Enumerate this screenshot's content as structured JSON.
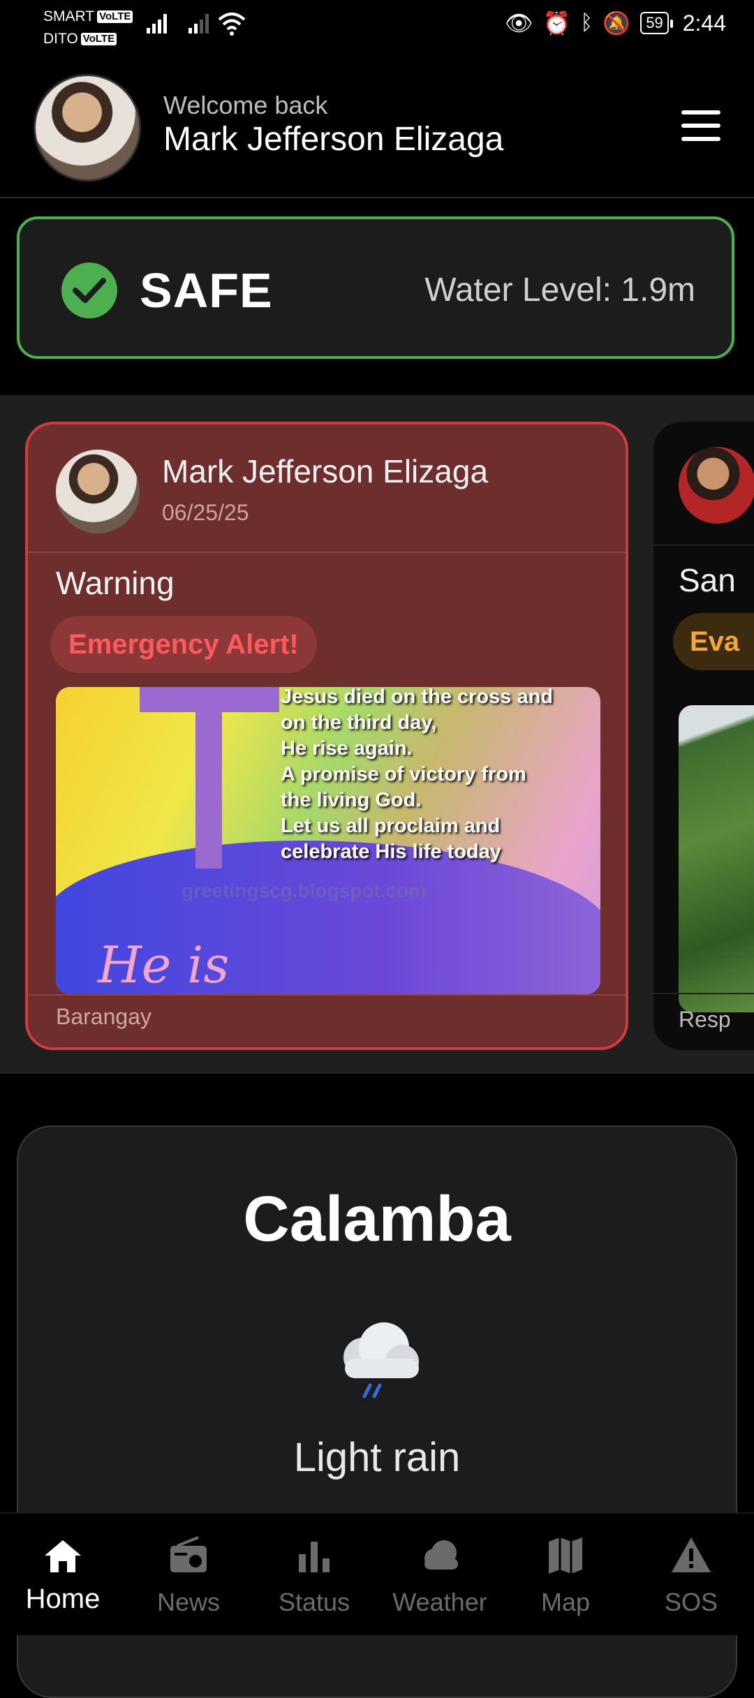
{
  "status_bar": {
    "carrier1": "SMART",
    "carrier2": "DITO",
    "volte": "VoLTE",
    "battery": "59",
    "time": "2:44"
  },
  "header": {
    "welcome": "Welcome back",
    "username": "Mark Jefferson Elizaga"
  },
  "safety": {
    "status": "SAFE",
    "water_level": "Water Level: 1.9m",
    "color": "#4caf50"
  },
  "posts": [
    {
      "author": "Mark Jefferson Elizaga",
      "date": "06/25/25",
      "type": "Warning",
      "badge": "Emergency Alert!",
      "image_text": "Jesus died on the cross and\non the third day,\nHe rise again.\nA promise of victory from\nthe living God.\nLet us all proclaim and\ncelebrate His life today",
      "image_watermark": "greetingscg.blogspot.com",
      "image_script": "He is",
      "footer": "Barangay",
      "accent": "#d23b3b"
    },
    {
      "author": "San",
      "badge": "Eva",
      "footer": "Resp",
      "accent": "#f3a63a"
    }
  ],
  "weather": {
    "city": "Calamba",
    "icon": "rain-cloud-icon",
    "description": "Light rain"
  },
  "nav": {
    "items": [
      {
        "label": "Home",
        "icon": "home-icon",
        "active": true
      },
      {
        "label": "News",
        "icon": "radio-icon",
        "active": false
      },
      {
        "label": "Status",
        "icon": "bar-chart-icon",
        "active": false
      },
      {
        "label": "Weather",
        "icon": "cloud-icon",
        "active": false
      },
      {
        "label": "Map",
        "icon": "map-icon",
        "active": false
      },
      {
        "label": "SOS",
        "icon": "warning-icon",
        "active": false
      }
    ]
  }
}
